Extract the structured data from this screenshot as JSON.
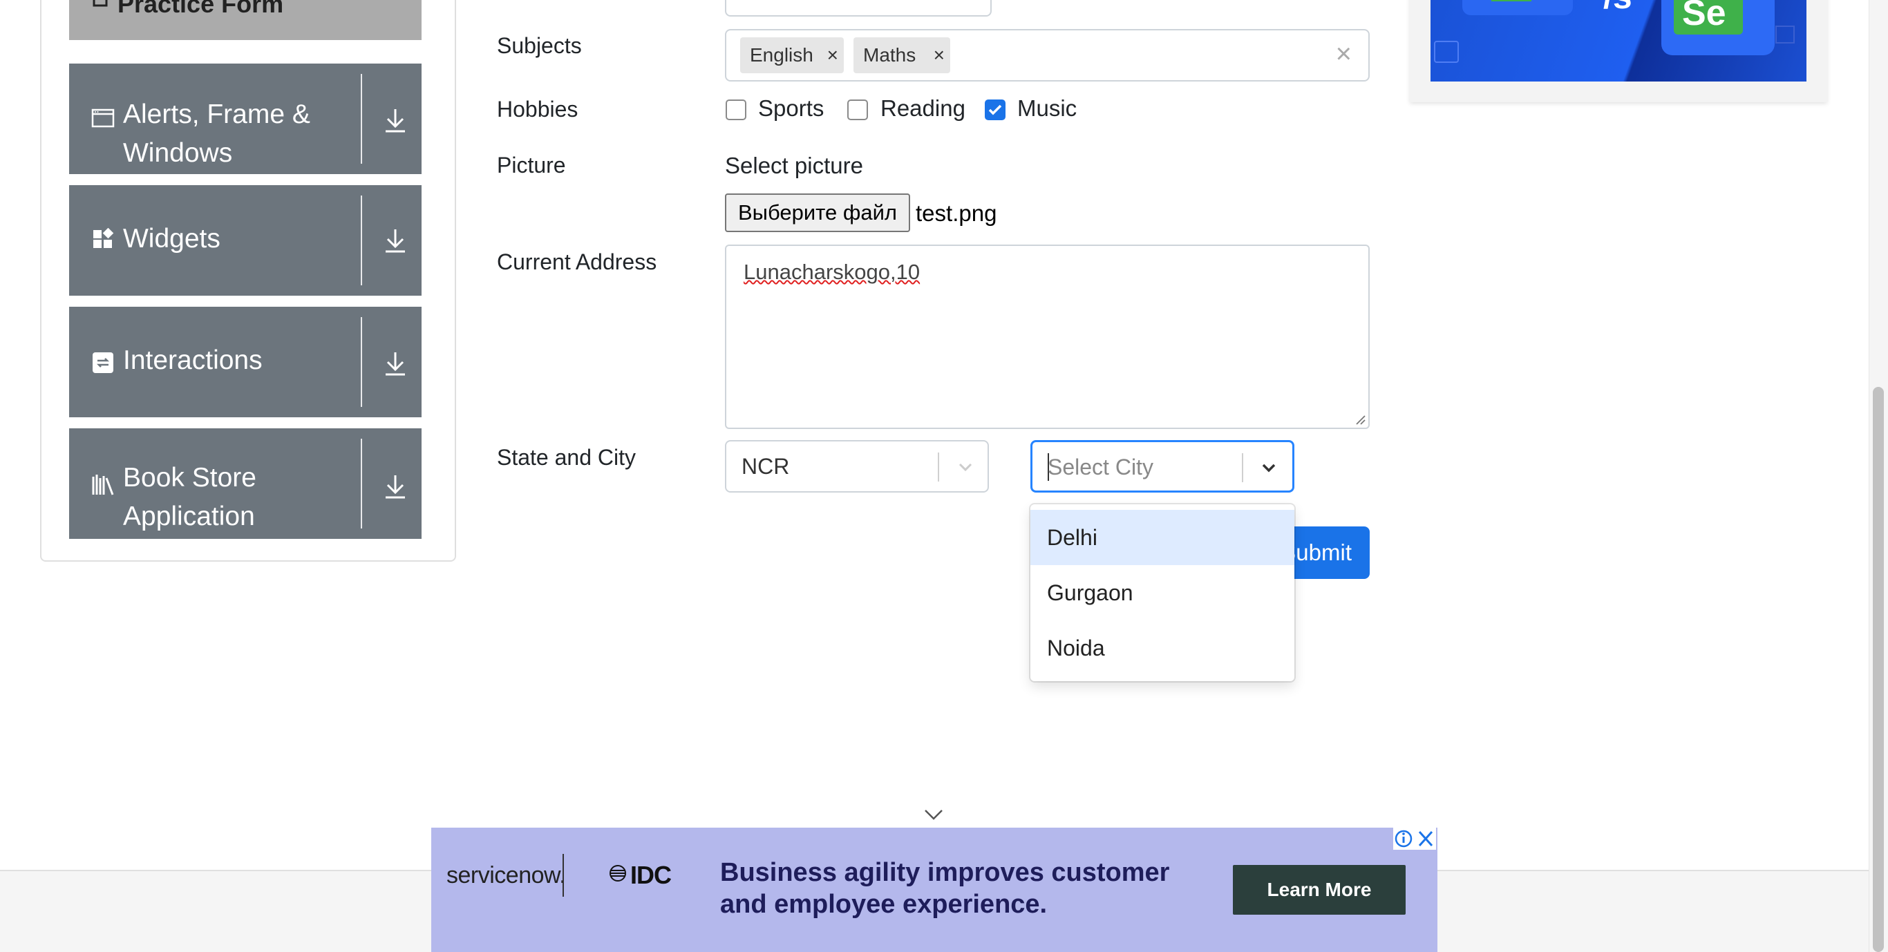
{
  "sidebar": {
    "top_partial_label": "Practice Form",
    "groups": [
      {
        "label": "Alerts, Frame & Windows",
        "icon": "window-icon"
      },
      {
        "label": "Widgets",
        "icon": "widgets-icon"
      },
      {
        "label": "Interactions",
        "icon": "interactions-icon"
      },
      {
        "label": "Book Store Application",
        "icon": "bookstore-icon"
      }
    ]
  },
  "form": {
    "subjects": {
      "label": "Subjects",
      "chips": [
        "English",
        "Maths"
      ],
      "remove_glyph": "×",
      "clear_glyph": "×"
    },
    "hobbies": {
      "label": "Hobbies",
      "options": [
        {
          "label": "Sports",
          "checked": false
        },
        {
          "label": "Reading",
          "checked": false
        },
        {
          "label": "Music",
          "checked": true
        }
      ]
    },
    "picture": {
      "label": "Picture",
      "hint": "Select picture",
      "button": "Выберите файл",
      "filename": "test.png"
    },
    "address": {
      "label": "Current Address",
      "value": "Lunacharskogo,10"
    },
    "state_city": {
      "label": "State and City",
      "state_value": "NCR",
      "city_placeholder": "Select City",
      "city_options": [
        "Delhi",
        "Gurgaon",
        "Noida"
      ],
      "highlighted_option": "Delhi"
    },
    "submit_label": "Submit"
  },
  "bottom_ad": {
    "brand1": "servicenow.",
    "brand2": "IDC",
    "headline": "Business agility improves customer and employee experience.",
    "cta": "Learn More"
  },
  "colors": {
    "sidebar_group": "#6c757d",
    "primary": "#1a73e8",
    "focus_border": "#2684ff",
    "option_highlight": "#deebff",
    "ad_background": "#b4b8ec"
  }
}
